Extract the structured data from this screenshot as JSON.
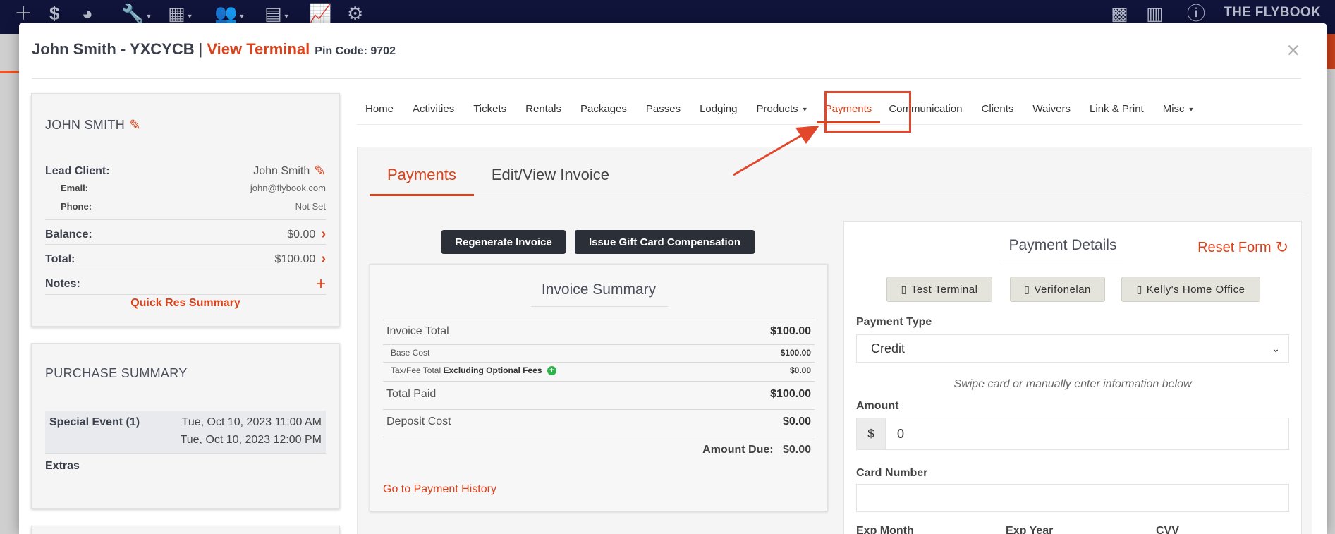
{
  "topbar": {
    "brand": "THE FLYBOOK"
  },
  "modal": {
    "client_title": "John Smith - YXCYCB",
    "separator": "|",
    "view_terminal": "View Terminal",
    "pin_code": "Pin Code: 9702",
    "close": "×"
  },
  "client_card": {
    "name": "JOHN SMITH",
    "lead_client_label": "Lead Client:",
    "lead_client_value": "John Smith",
    "email_label": "Email:",
    "email_value": "john@flybook.com",
    "phone_label": "Phone:",
    "phone_value": "Not Set",
    "balance_label": "Balance:",
    "balance_value": "$0.00",
    "total_label": "Total:",
    "total_value": "$100.00",
    "notes_label": "Notes:",
    "quick_res": "Quick Res Summary"
  },
  "purchase_summary": {
    "title": "PURCHASE SUMMARY",
    "item_label": "Special Event (1)",
    "start": "Tue, Oct 10, 2023 11:00 AM",
    "end": "Tue, Oct 10, 2023 12:00 PM",
    "extras": "Extras"
  },
  "nav": {
    "items": [
      {
        "label": "Home"
      },
      {
        "label": "Activities"
      },
      {
        "label": "Tickets"
      },
      {
        "label": "Rentals"
      },
      {
        "label": "Packages"
      },
      {
        "label": "Passes"
      },
      {
        "label": "Lodging"
      },
      {
        "label": "Products"
      },
      {
        "label": "Payments"
      },
      {
        "label": "Communication"
      },
      {
        "label": "Clients"
      },
      {
        "label": "Waivers"
      },
      {
        "label": "Link & Print"
      },
      {
        "label": "Misc"
      }
    ]
  },
  "subtabs": {
    "payments": "Payments",
    "edit_invoice": "Edit/View Invoice"
  },
  "actions": {
    "regenerate": "Regenerate Invoice",
    "gift_card": "Issue Gift Card Compensation"
  },
  "invoice": {
    "title": "Invoice Summary",
    "invoice_total_label": "Invoice Total",
    "invoice_total": "$100.00",
    "base_cost_label": "Base Cost",
    "base_cost": "$100.00",
    "tax_label": "Tax/Fee Total",
    "tax_note": "Excluding Optional Fees",
    "tax_value": "$0.00",
    "total_paid_label": "Total Paid",
    "total_paid": "$100.00",
    "deposit_label": "Deposit Cost",
    "deposit": "$0.00",
    "amount_due_label": "Amount Due:",
    "amount_due": "$0.00",
    "history_link": "Go to Payment History"
  },
  "payment_details": {
    "title": "Payment Details",
    "reset": "Reset Form",
    "terminals": [
      "Test Terminal",
      "Verifonelan",
      "Kelly's Home Office"
    ],
    "payment_type_label": "Payment Type",
    "payment_type": "Credit",
    "swipe_hint": "Swipe card or manually enter information below",
    "amount_label": "Amount",
    "currency": "$",
    "amount": "0",
    "card_number_label": "Card Number",
    "exp_month_label": "Exp Month",
    "exp_year_label": "Exp Year",
    "cvv_label": "CVV"
  },
  "colors": {
    "accent": "#d9421a",
    "topbar": "#10143a",
    "button_dark": "#2b2f38",
    "highlight": "#e2472b"
  }
}
